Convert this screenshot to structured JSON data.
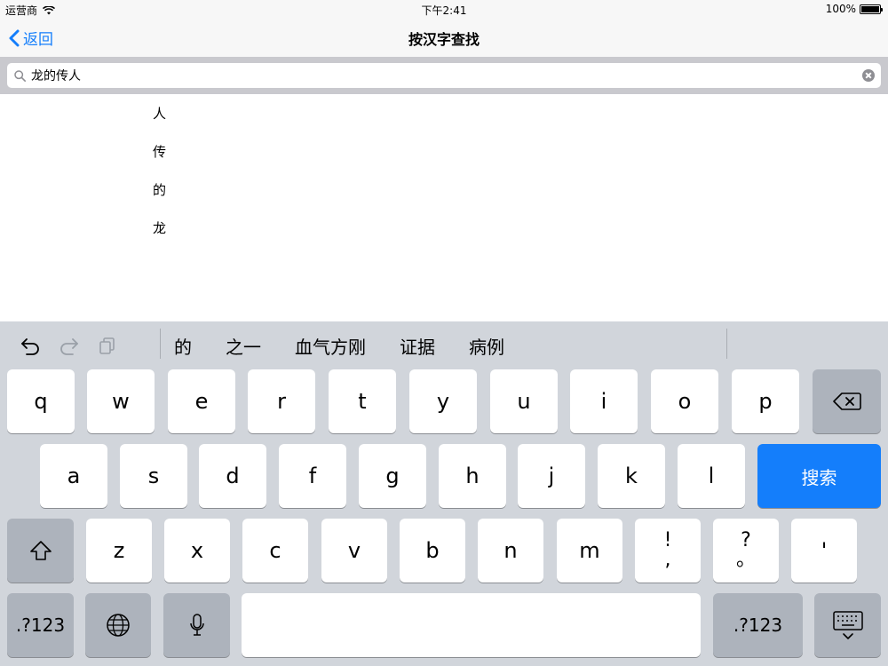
{
  "status_bar": {
    "carrier": "运营商",
    "time": "下午2:41",
    "battery": "100%"
  },
  "nav": {
    "back_label": "返回",
    "title": "按汉字查找"
  },
  "search": {
    "query": "龙的传人"
  },
  "results": [
    "人",
    "传",
    "的",
    "龙"
  ],
  "candidates": [
    "的",
    "之一",
    "血气方刚",
    "证据",
    "病例"
  ],
  "keyboard": {
    "row1": [
      "q",
      "w",
      "e",
      "r",
      "t",
      "y",
      "u",
      "i",
      "o",
      "p"
    ],
    "row2": [
      "a",
      "s",
      "d",
      "f",
      "g",
      "h",
      "j",
      "k",
      "l"
    ],
    "search_key": "搜索",
    "row3": [
      "z",
      "x",
      "c",
      "v",
      "b",
      "n",
      "m"
    ],
    "punct1": {
      "top": "!",
      "bottom": ","
    },
    "punct2": {
      "top": "?",
      "bottom": "。"
    },
    "punct3": "'",
    "numbers_key": ".?123"
  }
}
